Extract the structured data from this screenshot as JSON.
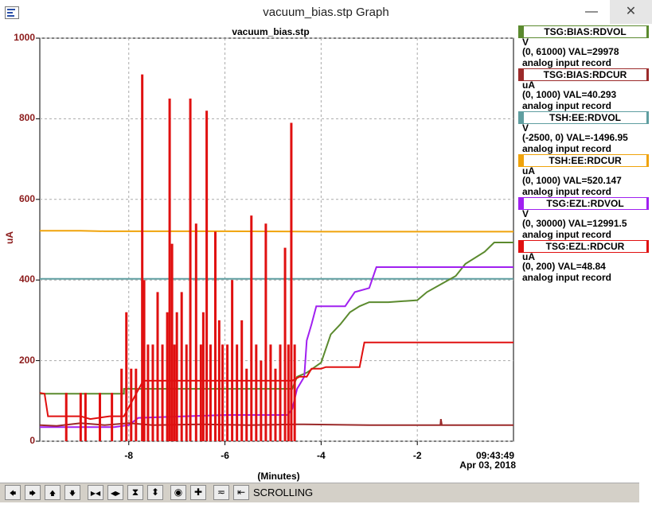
{
  "window": {
    "title": "vacuum_bias.stp Graph",
    "minimize": "—",
    "close": "✕"
  },
  "plot": {
    "title": "vacuum_bias.stp",
    "status_time": "09:43:49",
    "status_date": "Apr 03, 2018"
  },
  "legend": [
    {
      "pv": "TSG:BIAS:RDVOL",
      "units": "V",
      "range_val": "(0, 61000) VAL=29978",
      "rtype": "analog input record",
      "color": "#5b8a2e"
    },
    {
      "pv": "TSG:BIAS:RDCUR",
      "units": "uA",
      "range_val": "(0, 1000) VAL=40.293",
      "rtype": "analog input record",
      "color": "#9b2a2a"
    },
    {
      "pv": "TSH:EE:RDVOL",
      "units": "V",
      "range_val": "(-2500, 0)  VAL=-1496.95",
      "rtype": "analog input record",
      "color": "#5f9ea0"
    },
    {
      "pv": "TSH:EE:RDCUR",
      "units": "uA",
      "range_val": "(0, 1000) VAL=520.147",
      "rtype": "analog input record",
      "color": "#f0a30a"
    },
    {
      "pv": "TSG:EZL:RDVOL",
      "units": "V",
      "range_val": "(0, 30000) VAL=12991.5",
      "rtype": "analog input record",
      "color": "#a020f0"
    },
    {
      "pv": "TSG:EZL:RDCUR",
      "units": "uA",
      "range_val": "(0, 200) VAL=48.84",
      "rtype": "analog input record",
      "color": "#e01010"
    }
  ],
  "toolbar": {
    "status": "SCROLLING",
    "buttons": [
      {
        "name": "scroll-left-button",
        "icon": "arrow-left-icon",
        "glyph": "🡄"
      },
      {
        "name": "scroll-right-button",
        "icon": "arrow-right-icon",
        "glyph": "🡆"
      },
      {
        "name": "scroll-up-button",
        "icon": "arrow-up-icon",
        "glyph": "🡅"
      },
      {
        "name": "scroll-down-button",
        "icon": "arrow-down-icon",
        "glyph": "🡇"
      },
      {
        "name": "zoom-in-x-button",
        "icon": "zoom-in-x-icon",
        "glyph": "▶◀"
      },
      {
        "name": "zoom-out-x-button",
        "icon": "zoom-out-x-icon",
        "glyph": "◀▶"
      },
      {
        "name": "zoom-in-y-button",
        "icon": "zoom-in-y-icon",
        "glyph": "⧗"
      },
      {
        "name": "zoom-out-y-button",
        "icon": "zoom-out-y-icon",
        "glyph": "⬍"
      },
      {
        "name": "center-button",
        "icon": "target-icon",
        "glyph": "◉"
      },
      {
        "name": "crosshair-button",
        "icon": "crosshair-icon",
        "glyph": "✚"
      },
      {
        "name": "autoscale-button",
        "icon": "autoscale-icon",
        "glyph": "≂"
      },
      {
        "name": "scroll-mode-button",
        "icon": "scroll-mode-icon",
        "glyph": "⇤"
      }
    ]
  },
  "chart_data": {
    "type": "line",
    "title": "vacuum_bias.stp",
    "xlabel": "(Minutes)",
    "ylabel": "uA",
    "xlim": [
      -9.85,
      0
    ],
    "ylim": [
      0,
      1000
    ],
    "xticks": [
      -8,
      -6,
      -4,
      -2
    ],
    "yticks": [
      0,
      200,
      400,
      600,
      800,
      1000
    ],
    "grid": true,
    "legend_position": "right",
    "series": [
      {
        "name": "TSH:EE:RDCUR",
        "color": "#f0a30a",
        "points": [
          [
            -9.85,
            522
          ],
          [
            -9.0,
            522
          ],
          [
            -8.5,
            521
          ],
          [
            -6.0,
            521
          ],
          [
            -4.0,
            520
          ],
          [
            0,
            520
          ]
        ]
      },
      {
        "name": "TSH:EE:RDVOL",
        "color": "#5f9ea0",
        "points": [
          [
            -9.85,
            403
          ],
          [
            0,
            403
          ]
        ]
      },
      {
        "name": "TSG:BIAS:RDVOL",
        "color": "#5b8a2e",
        "points": [
          [
            -9.85,
            118
          ],
          [
            -8.1,
            118
          ],
          [
            -8.1,
            130
          ],
          [
            -4.6,
            130
          ],
          [
            -4.5,
            160
          ],
          [
            -4.3,
            170
          ],
          [
            -4.0,
            195
          ],
          [
            -3.8,
            265
          ],
          [
            -3.6,
            290
          ],
          [
            -3.4,
            320
          ],
          [
            -3.2,
            335
          ],
          [
            -3.0,
            345
          ],
          [
            -2.6,
            345
          ],
          [
            -2.0,
            350
          ],
          [
            -1.8,
            370
          ],
          [
            -1.5,
            390
          ],
          [
            -1.2,
            410
          ],
          [
            -1.0,
            440
          ],
          [
            -0.6,
            470
          ],
          [
            -0.4,
            493
          ],
          [
            0,
            493
          ]
        ]
      },
      {
        "name": "TSG:EZL:RDVOL",
        "color": "#a020f0",
        "points": [
          [
            -9.85,
            35
          ],
          [
            -8.3,
            35
          ],
          [
            -8.0,
            40
          ],
          [
            -7.8,
            58
          ],
          [
            -6.0,
            65
          ],
          [
            -4.7,
            65
          ],
          [
            -4.6,
            80
          ],
          [
            -4.5,
            130
          ],
          [
            -4.35,
            160
          ],
          [
            -4.3,
            250
          ],
          [
            -4.2,
            290
          ],
          [
            -4.1,
            335
          ],
          [
            -3.5,
            335
          ],
          [
            -3.3,
            370
          ],
          [
            -3.0,
            380
          ],
          [
            -2.85,
            432
          ],
          [
            0,
            432
          ]
        ]
      },
      {
        "name": "TSG:EZL:RDCUR",
        "color": "#e01010",
        "points": [
          [
            -9.85,
            120
          ],
          [
            -9.75,
            118
          ],
          [
            -9.68,
            62
          ],
          [
            -9.0,
            62
          ],
          [
            -8.8,
            55
          ],
          [
            -8.4,
            62
          ],
          [
            -8.1,
            62
          ],
          [
            -7.7,
            150
          ],
          [
            -7.0,
            150
          ],
          [
            -6.0,
            150
          ],
          [
            -5.0,
            150
          ],
          [
            -4.6,
            150
          ],
          [
            -4.45,
            160
          ],
          [
            -4.3,
            160
          ],
          [
            -4.2,
            180
          ],
          [
            -4.0,
            180
          ],
          [
            -3.9,
            184
          ],
          [
            -3.2,
            184
          ],
          [
            -3.1,
            245
          ],
          [
            0,
            245
          ]
        ]
      },
      {
        "name": "TSG:BIAS:RDCUR",
        "color": "#9b2a2a",
        "points": [
          [
            -9.85,
            40
          ],
          [
            -9.5,
            38
          ],
          [
            -9.0,
            45
          ],
          [
            -8.5,
            40
          ],
          [
            -8.0,
            45
          ],
          [
            -7.5,
            40
          ],
          [
            -6.5,
            42
          ],
          [
            -5.5,
            40
          ],
          [
            -4.5,
            42
          ],
          [
            -3.0,
            40
          ],
          [
            -2.0,
            40
          ],
          [
            -1.52,
            40
          ],
          [
            -1.51,
            55
          ],
          [
            -1.49,
            40
          ],
          [
            0,
            40
          ]
        ]
      }
    ],
    "spikes": {
      "series": "TSG:EZL:RDCUR",
      "x": [
        -9.3,
        -9.0,
        -8.9,
        -8.6,
        -8.35,
        -8.15,
        -8.05,
        -7.95,
        -7.85,
        -7.72,
        -7.68,
        -7.6,
        -7.5,
        -7.4,
        -7.3,
        -7.2,
        -7.15,
        -7.1,
        -7.05,
        -7.0,
        -6.9,
        -6.8,
        -6.72,
        -6.6,
        -6.5,
        -6.45,
        -6.38,
        -6.3,
        -6.2,
        -6.12,
        -6.05,
        -5.95,
        -5.85,
        -5.75,
        -5.65,
        -5.55,
        -5.45,
        -5.35,
        -5.25,
        -5.15,
        -5.05,
        -4.95,
        -4.85,
        -4.75,
        -4.68,
        -4.62,
        -4.55
      ],
      "y": [
        120,
        120,
        120,
        120,
        120,
        180,
        320,
        180,
        180,
        910,
        400,
        240,
        240,
        370,
        240,
        320,
        850,
        490,
        240,
        320,
        370,
        240,
        850,
        540,
        240,
        320,
        820,
        240,
        520,
        300,
        240,
        240,
        400,
        240,
        300,
        180,
        560,
        240,
        200,
        540,
        240,
        180,
        240,
        480,
        240,
        790,
        240
      ]
    }
  }
}
